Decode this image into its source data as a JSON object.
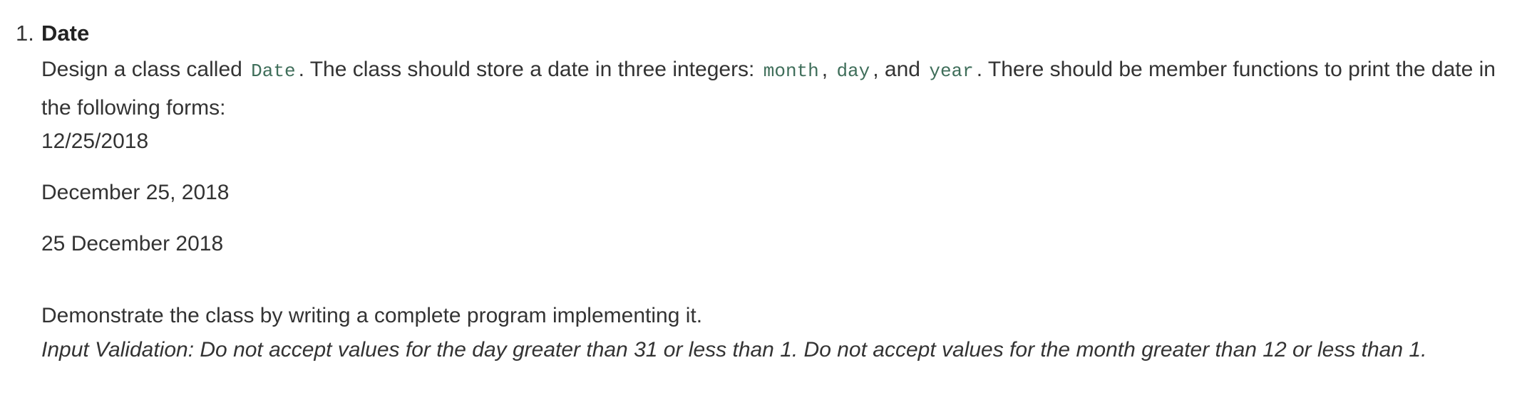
{
  "item": {
    "number": "1.",
    "title": "Date"
  },
  "description": {
    "part1": "Design a class called",
    "class_name": "Date",
    "part2": ". The class should store a date in three integers:",
    "field_month": "month",
    "sep1": ",",
    "field_day": "day",
    "part3": ", and",
    "field_year": "year",
    "part4": ". There should be member functions to print the date in the following forms:"
  },
  "forms": [
    "12/25/2018",
    "December 25, 2018",
    "25 December 2018"
  ],
  "demonstrate": "Demonstrate the class by writing a complete program implementing it.",
  "validation": "Input Validation: Do not accept values for the day greater than 31 or less than 1. Do not accept values for the month greater than 12 or less than 1."
}
